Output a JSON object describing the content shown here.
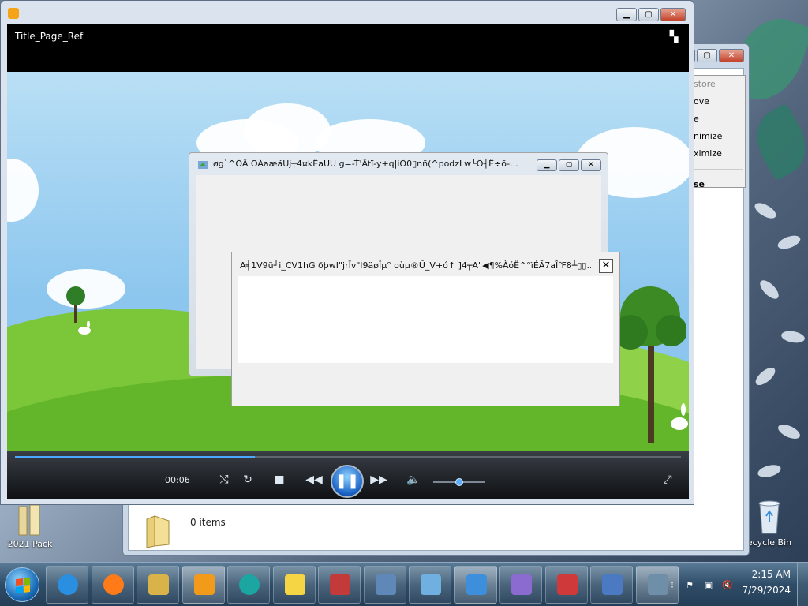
{
  "desktop": {
    "icons": [
      {
        "label": "2021 Pack"
      },
      {
        "label": "ecycle Bin"
      }
    ]
  },
  "explorer": {
    "status": "0 items",
    "menu": [
      "store",
      "ove",
      "e",
      "nimize",
      "ximize",
      "se"
    ]
  },
  "media_player": {
    "window_title": "Title_Page_Ref",
    "elapsed": "00:06",
    "progress_fraction": 0.36,
    "volume_fraction": 0.5,
    "play_state_icon": "pause-icon"
  },
  "dialogs": {
    "back_title": "øg`^ÕÄ    OÃaæäÜj┬4¤kÊaÜÜ    g=-Ť'Ätï-y+q|iÕ0▯nñ(^podzLw└Õ┤Ë÷õ-...",
    "front_title": "A╡1V9ü┘i_CV1hG ðþwI\"jrĪv\"l9äøÎµ°    oùµ®Ü_V+ó↑ ]4┬A\"◀¶%ÀóË^°ïÉÃ7aÎ℉8┴▯▯..."
  },
  "taskbar": {
    "time": "2:15 AM",
    "date": "7/29/2024",
    "apps": [
      "internet-explorer-icon",
      "firefox-icon",
      "file-explorer-icon",
      "media-player-icon",
      "media-center-icon",
      "sticky-notes-icon",
      "paint-icon",
      "window-icon",
      "gadget-icon",
      "photo-viewer-icon",
      "tasks-icon",
      "network-icon",
      "wordpad-icon",
      "remote-desktop-icon"
    ]
  },
  "colors": {
    "accent": "#1c6eb8",
    "video_sky": "#8cc6ee",
    "grass": "#6fbe2e"
  }
}
